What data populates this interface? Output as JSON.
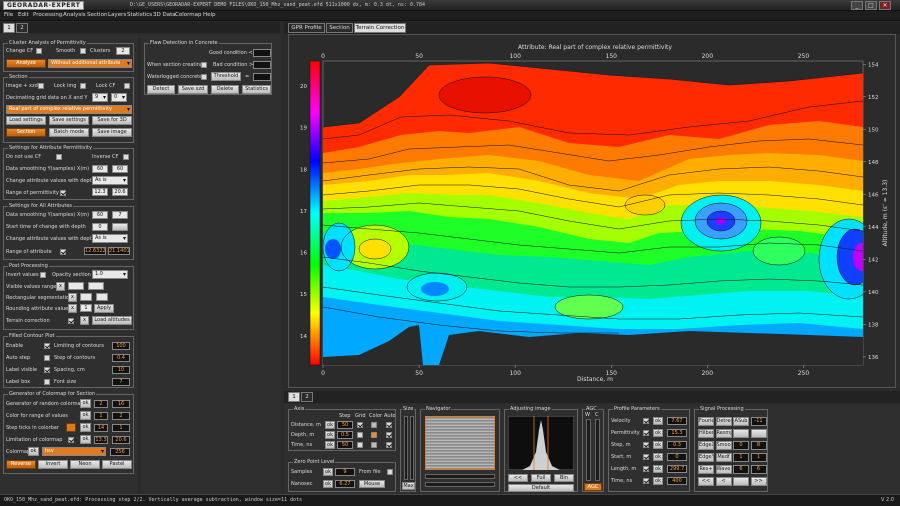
{
  "app": {
    "logo": "GEORADAR-EXPERT",
    "title": "D:\\GE_USERS\\GEORADAR-EXPERT DEMO FILES\\OKO_150_Mhz_sand_peat.efd   511x1000   dx, m: 0.3   dt, ns: 0.784",
    "min": "_",
    "max": "□",
    "close": "✕"
  },
  "menu": [
    "File",
    "Edit",
    "Processing",
    "Analysis",
    "Section",
    "Layers",
    "Statistics",
    "3D Data",
    "Colormap",
    "Help"
  ],
  "left_tabs": [
    "1",
    "2"
  ],
  "cluster": {
    "title": "Cluster Analysis of Permittivity",
    "change_cf": "Change CF",
    "smooth": "Smooth",
    "clusters": "Clusters",
    "clusters_val": "2",
    "analyze": "Analyze",
    "mode": "Without additional attribute"
  },
  "section": {
    "title": "Section",
    "image_xzd": "Image + xzd",
    "lock_img": "Lock img",
    "lock_cf": "Lock CF",
    "decimating": "Decimating grid data on X and Y",
    "dec_x": "9",
    "dec_y": "0",
    "attribute": "Real part of complex relative permittivity",
    "load_settings": "Load settings",
    "save_settings": "Save settings",
    "save_3d": "Save for 3D",
    "section_btn": "Section",
    "batch": "Batch mode",
    "save_image": "Save image"
  },
  "perm": {
    "title": "Settings for Attribute Permittivity",
    "no_cf": "Do not use CF",
    "inverse": "Inverse CF",
    "smoothing": "Data smoothing  Y(samples)  X(m)",
    "sy": "60",
    "sx": "60",
    "change": "Change attribute values with depth",
    "change_val": "As is",
    "range": "Range of permittivity",
    "r1": "12.3",
    "r2": "20.6"
  },
  "all": {
    "title": "Settings for All Attributes",
    "smoothing": "Data smoothing  Y(samples)  X(m)",
    "sy": "60",
    "sx": "7",
    "start": "Start time of change with depth",
    "start_val": "0",
    "change": "Change attribute values with depth",
    "change_val": "As is",
    "range": "Range of attribute",
    "r1": "12.6322",
    "r2": "21.1401"
  },
  "post": {
    "title": "Post Processing",
    "invert": "Invert values",
    "opacity": "Opacity section",
    "opacity_val": "1.0",
    "visible": "Visible values range",
    "rect": "Rectangular segmentation",
    "rounding": "Rounding attribute values",
    "round_val": "1",
    "apply": "Apply",
    "terrain": "Terrain correction",
    "load_alt": "Load altitudes"
  },
  "contour": {
    "title": "Filled Contour Plot",
    "enable": "Enable",
    "limiting": "Limiting of contours",
    "lim_val": "100",
    "autostep": "Auto step",
    "stepc": "Step of contours",
    "stepc_val": "0.4",
    "labelvis": "Label visible",
    "spacing": "Spacing, cm",
    "spacing_val": "10",
    "labelbox": "Label box",
    "fontsize": "Font size",
    "font_val": "7"
  },
  "gen": {
    "title": "Generator of Colormap for Section",
    "random": "Generator of random colormap",
    "g1": "2",
    "g2": "16",
    "range": "Color for range of values",
    "rv1": "1",
    "rv2": "2",
    "ticks": "Step ticks in colorbar",
    "t1": "14",
    "t2": "1",
    "limit": "Limitation of colormap",
    "l1": "13.3",
    "l2": "20.6",
    "colormap": "Colormap",
    "cmap": "hsv",
    "cmap_n": "256",
    "reverse": "Reverse",
    "invert": "Invert",
    "neon": "Neon",
    "pastel": "Pastel"
  },
  "flaw": {
    "title": "Flaw Detection in Concrete",
    "good": "Good condition <",
    "when": "When section creating",
    "bad": "Bad condition >",
    "water": "Waterlogged concrete",
    "threshold": "Threshold",
    "eq": "=",
    "detect": "Detect",
    "save_xzd": "Save xzd",
    "delete": "Delete",
    "stats": "Statistics"
  },
  "right_tabs": [
    "GPR Profile",
    "Section",
    "Terrain Correction"
  ],
  "chart_data": {
    "type": "heatmap",
    "title": "Attribute:  Real part of complex relative permittivity",
    "xlabel": "Distance, m",
    "ylabel_right": "Altitude, m (ε' = 13.3)",
    "x_ticks": [
      "0",
      "50",
      "100",
      "150",
      "200",
      "250"
    ],
    "y_left_ticks": [
      "20",
      "19",
      "18",
      "17",
      "16",
      "15",
      "14"
    ],
    "y_right_ticks": [
      "154",
      "152",
      "150",
      "148",
      "146",
      "144",
      "142",
      "140",
      "138",
      "136"
    ],
    "xlim": [
      0,
      281
    ],
    "ylim_right": [
      135.5,
      154.2
    ],
    "colorbar_range": [
      13.3,
      20.6
    ],
    "colormap": "hsv"
  },
  "bottom_tabs": [
    "1",
    "2"
  ],
  "axis": {
    "title": "Axis",
    "step": "Step",
    "grid": "Grid",
    "color": "Color",
    "auto": "Auto",
    "distance": "Distance, m",
    "dist_val": "50",
    "depth": "Depth, m",
    "depth_val": "0.5",
    "time": "Time, ns",
    "time_val": "50"
  },
  "zero": {
    "title": "Zero Point Level",
    "samples": "Samples",
    "samples_val": "9",
    "fromfile": "From file",
    "nanosec": "Nanosec",
    "nano_val": "6.27",
    "mouse": "Mouse"
  },
  "size": {
    "title": "Size",
    "max": "Max"
  },
  "navigator": {
    "title": "Navigator"
  },
  "adjust": {
    "title": "Adjusting image",
    "full": "Full",
    "bin": "Bin",
    "default": "Default"
  },
  "agc": {
    "title": "AGC",
    "w": "W",
    "c": "C",
    "bright": "Bright",
    "agc_btn": "AGC"
  },
  "profile": {
    "title": "Profile Parameters",
    "velocity": "Velocity",
    "vel_val": "7.67",
    "perm": "Permittivity",
    "perm_val": "15.3",
    "step": "Step, m",
    "step_val": "0.3",
    "start": "Start, m",
    "start_val": "0",
    "length": "Length, m",
    "len_val": "299.7",
    "time": "Time, ns",
    "time_val": "400"
  },
  "signal": {
    "title": "Signal Processing",
    "b": [
      [
        "Fourier",
        "Detrend",
        "ASub",
        "-11"
      ],
      [
        "Hilbert",
        "Resmpl",
        "",
        ""
      ],
      [
        "EdgeX",
        "Smoo",
        "0",
        "8"
      ],
      [
        "EdgeY",
        "Medf",
        "1",
        "1"
      ],
      [
        "Res+",
        "Wave",
        "6",
        "6"
      ],
      [
        "<<",
        "<",
        "",
        ">>"
      ]
    ]
  },
  "status": {
    "text": "OKO_150_Mhz_sand_peat.efd:  Processing step 2/2.  Vertically average subtraction, window size=11 dots",
    "version": "V 2.0"
  }
}
